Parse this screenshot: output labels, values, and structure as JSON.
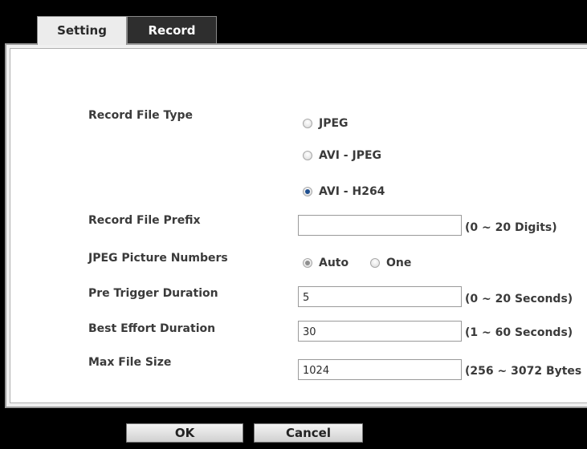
{
  "tabs": {
    "setting": "Setting",
    "record": "Record"
  },
  "form": {
    "record_file_type": {
      "label": "Record File Type",
      "options": [
        "JPEG",
        "AVI - JPEG",
        "AVI - H264"
      ],
      "selected": "AVI - H264"
    },
    "record_file_prefix": {
      "label": "Record File Prefix",
      "value": "",
      "unit": "(0 ~ 20 Digits)"
    },
    "jpeg_picture_numbers": {
      "label": "JPEG Picture Numbers",
      "options": [
        "Auto",
        "One"
      ],
      "selected": "Auto"
    },
    "pre_trigger_duration": {
      "label": "Pre Trigger Duration",
      "value": "5",
      "unit": "(0 ~ 20 Seconds)"
    },
    "best_effort_duration": {
      "label": "Best Effort Duration",
      "value": "30",
      "unit": "(1 ~ 60 Seconds)"
    },
    "max_file_size": {
      "label": "Max File Size",
      "value": "1024",
      "unit": "(256 ~ 3072 Bytes"
    }
  },
  "buttons": {
    "ok": "OK",
    "cancel": "Cancel"
  }
}
